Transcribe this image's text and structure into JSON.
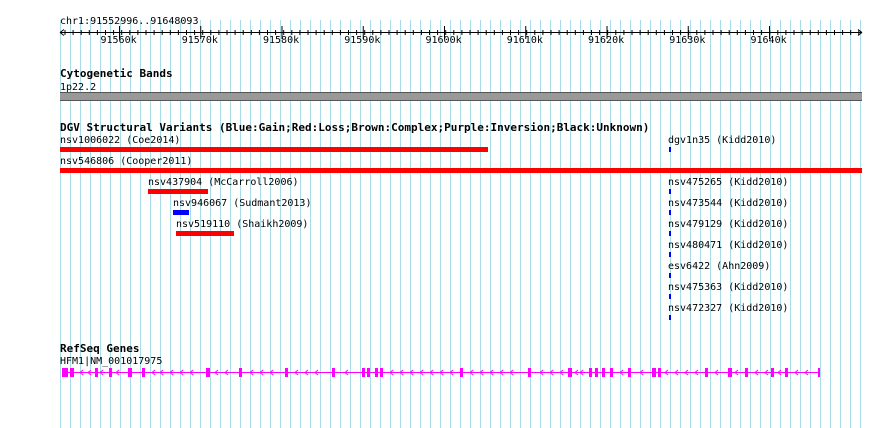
{
  "ruler": {
    "location": "chr1:91552996..91648093",
    "ticks": [
      "91560k",
      "91570k",
      "91580k",
      "91590k",
      "91600k",
      "91610k",
      "91620k",
      "91630k",
      "91640k"
    ]
  },
  "cytobands": {
    "title": "Cytogenetic Bands",
    "band": "1p22.2"
  },
  "dgv": {
    "title": "DGV Structural Variants (Blue:Gain;Red:Loss;Brown:Complex;Purple:Inversion;Black:Unknown)",
    "variants": [
      {
        "label": "nsv1006022 (Coe2014)",
        "type": "loss"
      },
      {
        "label": "nsv546806 (Cooper2011)",
        "type": "loss"
      },
      {
        "label": "nsv437904 (McCarroll2006)",
        "type": "loss"
      },
      {
        "label": "nsv946067 (Sudmant2013)",
        "type": "gain"
      },
      {
        "label": "nsv519110 (Shaikh2009)",
        "type": "loss"
      },
      {
        "label": "dgv1n35 (Kidd2010)",
        "type": "gain"
      },
      {
        "label": "nsv475265 (Kidd2010)",
        "type": "gain"
      },
      {
        "label": "nsv473544 (Kidd2010)",
        "type": "gain"
      },
      {
        "label": "nsv479129 (Kidd2010)",
        "type": "gain"
      },
      {
        "label": "nsv480471 (Kidd2010)",
        "type": "gain"
      },
      {
        "label": "esv6422 (Ahn2009)",
        "type": "gain"
      },
      {
        "label": "nsv475363 (Kidd2010)",
        "type": "gain"
      },
      {
        "label": "nsv472327 (Kidd2010)",
        "type": "gain"
      }
    ]
  },
  "refseq": {
    "title": "RefSeq Genes",
    "gene": "HFM1|NM_001017975"
  },
  "colors": {
    "gain": "#0000ff",
    "loss": "#ff0000",
    "gene": "#ff00ff",
    "grid": "#a8dde8",
    "band": "#999999"
  }
}
